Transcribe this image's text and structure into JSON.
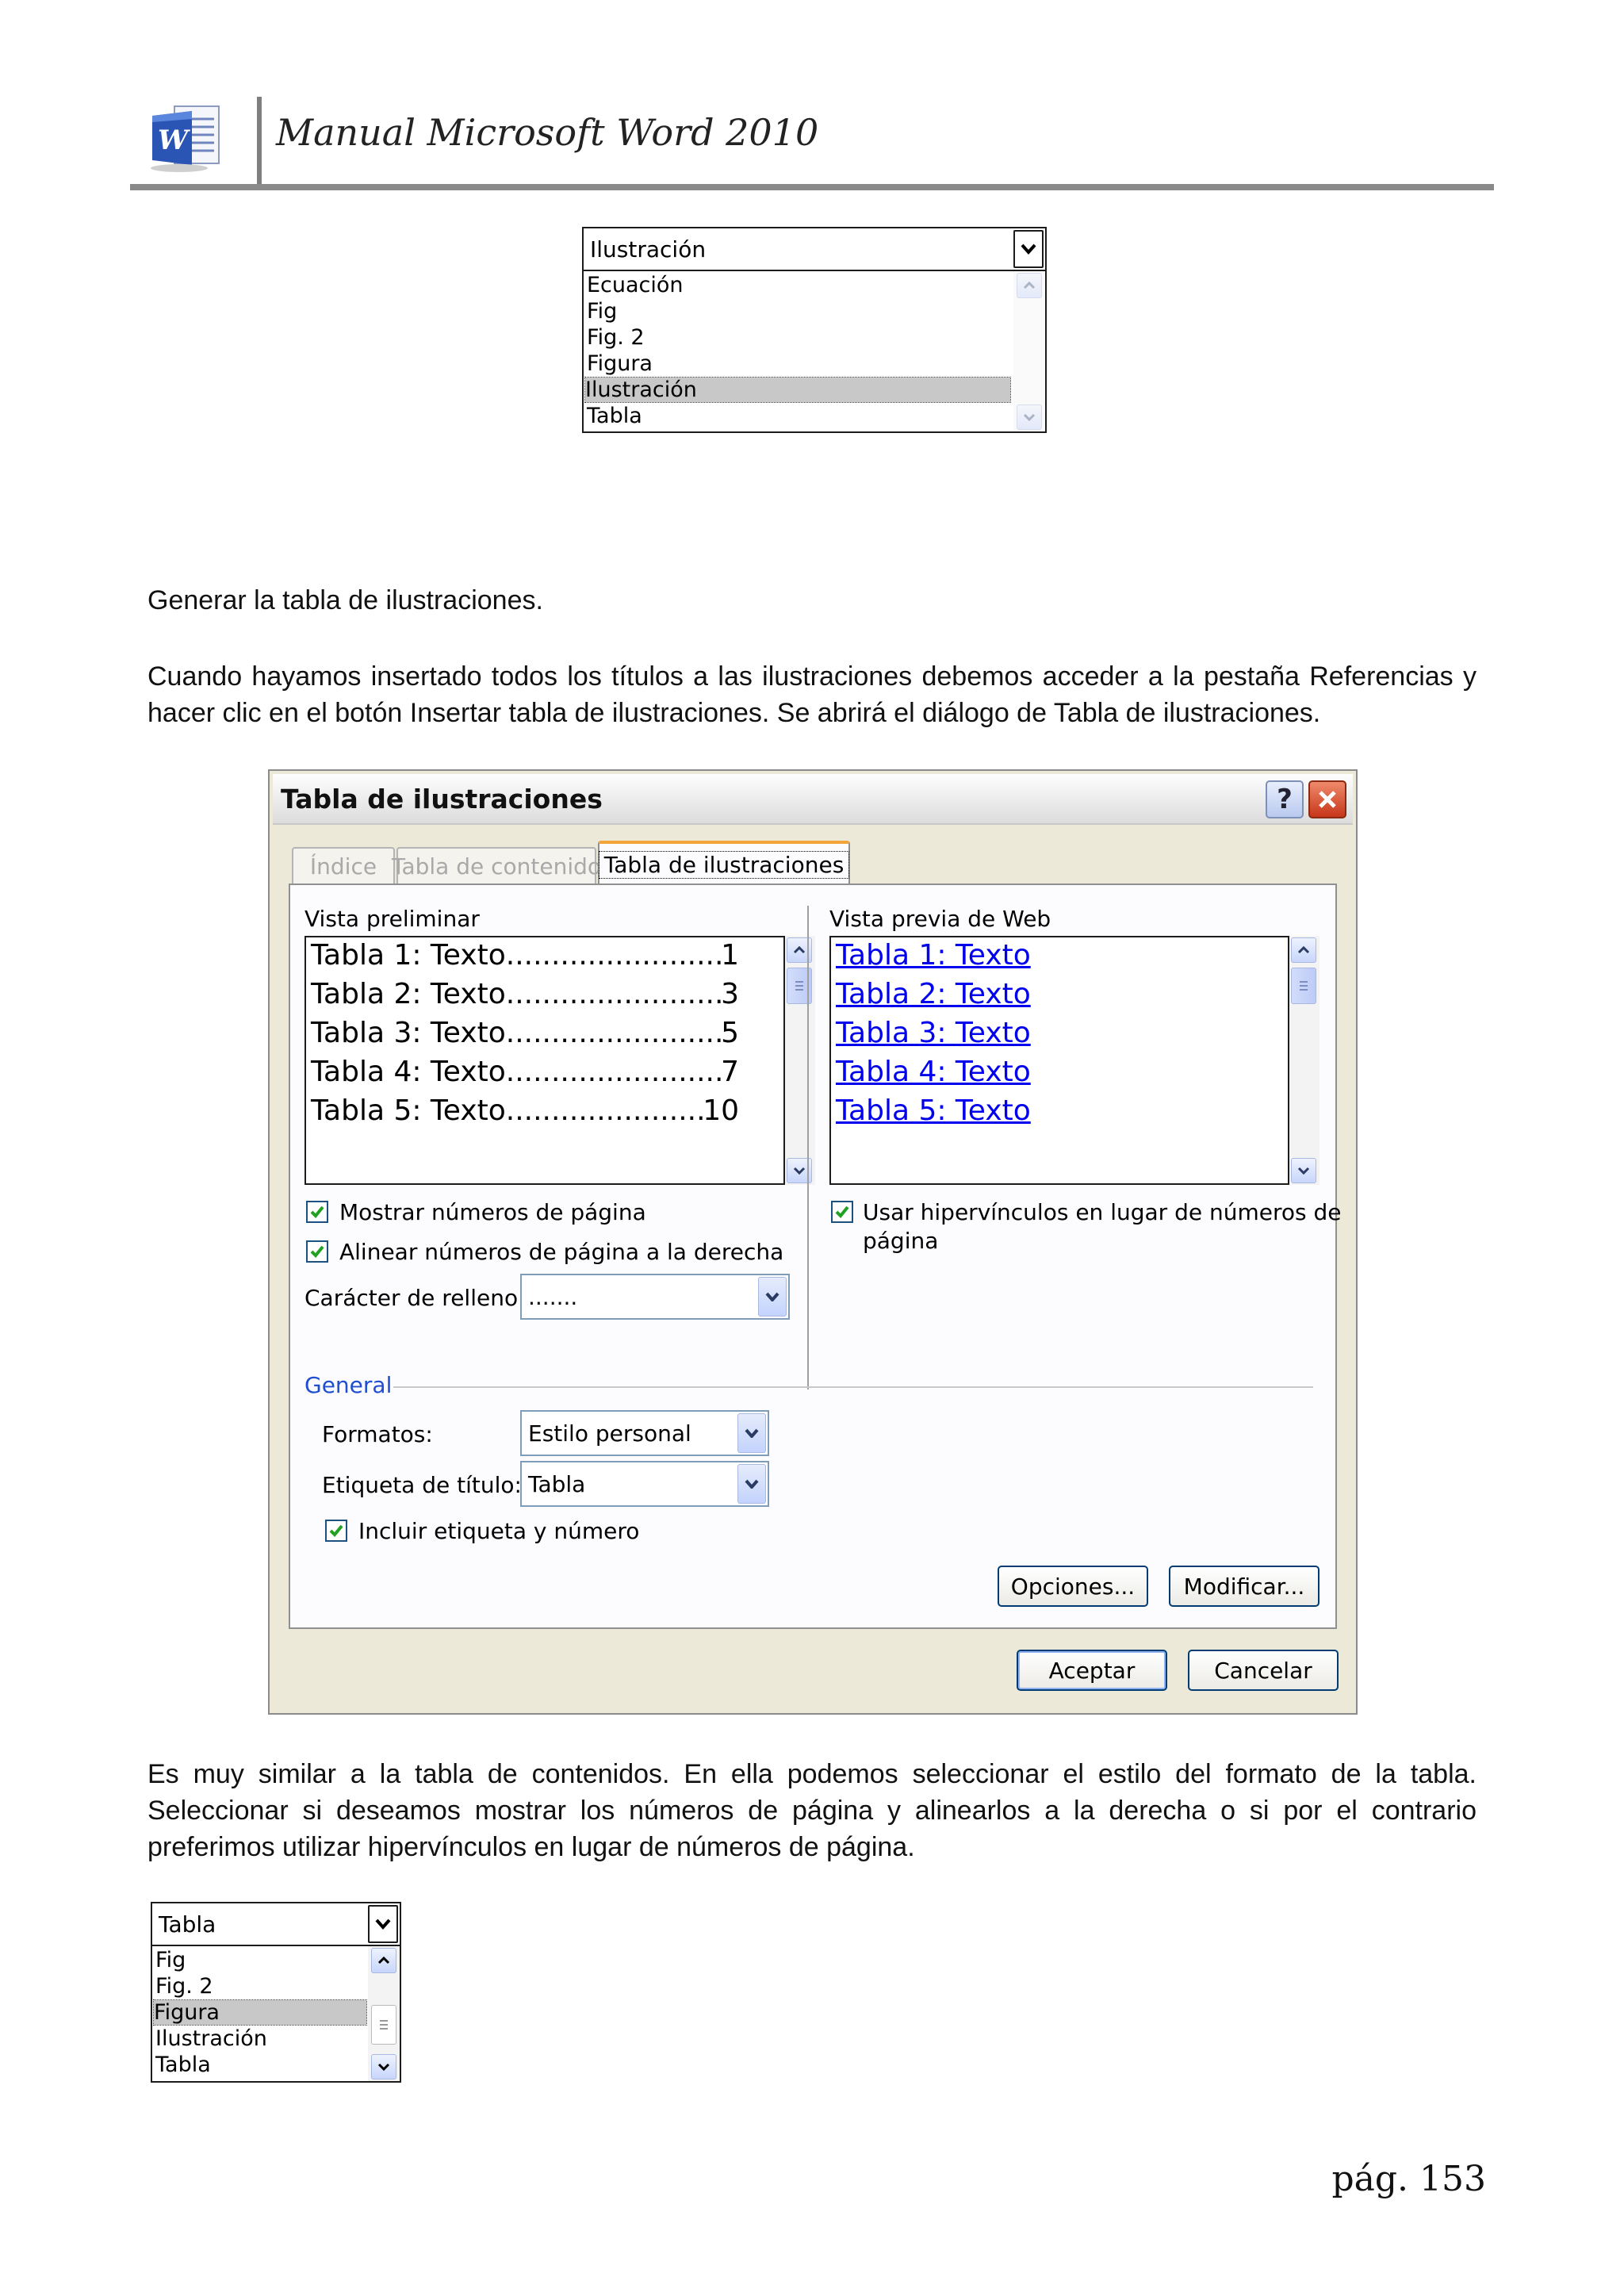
{
  "header": {
    "title": "Manual Microsoft Word 2010",
    "logo_icon": "word-logo-icon"
  },
  "combo1": {
    "value": "Ilustración",
    "items": [
      "Ecuación",
      "Fig",
      "Fig. 2",
      "Figura",
      "Ilustración",
      "Tabla"
    ],
    "selected": "Ilustración"
  },
  "paragraphs": {
    "p1": "Generar la tabla de ilustraciones.",
    "p2": "Cuando hayamos insertado todos los títulos a las ilustraciones debemos acceder a la pestaña Referencias y hacer clic en el botón Insertar tabla de ilustraciones. Se abrirá el diálogo de Tabla de ilustraciones.",
    "p3": "Es muy similar a la tabla de contenidos. En ella podemos seleccionar el estilo del formato de la tabla. Seleccionar si deseamos mostrar los números de página y alinearlos a la derecha o si por el contrario preferimos utilizar hipervínculos en lugar de números de página."
  },
  "dialog": {
    "title": "Tabla de ilustraciones",
    "help_label": "?",
    "tabs": [
      "Índice",
      "Tabla de contenido",
      "Tabla de ilustraciones"
    ],
    "active_tab": "Tabla de ilustraciones",
    "print_preview": {
      "label": "Vista preliminar",
      "entries": [
        {
          "text": "Tabla 1: Texto",
          "page": "1"
        },
        {
          "text": "Tabla 2: Texto",
          "page": "3"
        },
        {
          "text": "Tabla 3: Texto",
          "page": "5"
        },
        {
          "text": "Tabla 4: Texto",
          "page": "7"
        },
        {
          "text": "Tabla 5: Texto",
          "page": "10"
        }
      ]
    },
    "web_preview": {
      "label": "Vista previa de Web",
      "entries": [
        "Tabla 1: Texto",
        "Tabla 2: Texto",
        "Tabla 3: Texto",
        "Tabla 4: Texto",
        "Tabla 5: Texto"
      ]
    },
    "show_page_numbers": {
      "label": "Mostrar números de página",
      "checked": true
    },
    "align_right": {
      "label": "Alinear números de página a la derecha",
      "checked": true
    },
    "tab_leader": {
      "label": "Carácter de relleno:",
      "value": "......."
    },
    "use_hyperlinks": {
      "label_line1": "Usar hipervínculos en lugar de números de",
      "label_line2": "página",
      "checked": true
    },
    "general": {
      "label": "General",
      "formats_label": "Formatos:",
      "formats_value": "Estilo personal",
      "caption_label": "Etiqueta de título:",
      "caption_value": "Tabla",
      "include_label": {
        "label": "Incluir etiqueta y número",
        "checked": true
      }
    },
    "buttons": {
      "options": "Opciones...",
      "modify": "Modificar...",
      "ok": "Aceptar",
      "cancel": "Cancelar"
    }
  },
  "combo2": {
    "value": "Tabla",
    "items": [
      "Fig",
      "Fig. 2",
      "Figura",
      "Ilustración",
      "Tabla"
    ],
    "selected": "Figura"
  },
  "footer": {
    "page": "pág. 153"
  }
}
